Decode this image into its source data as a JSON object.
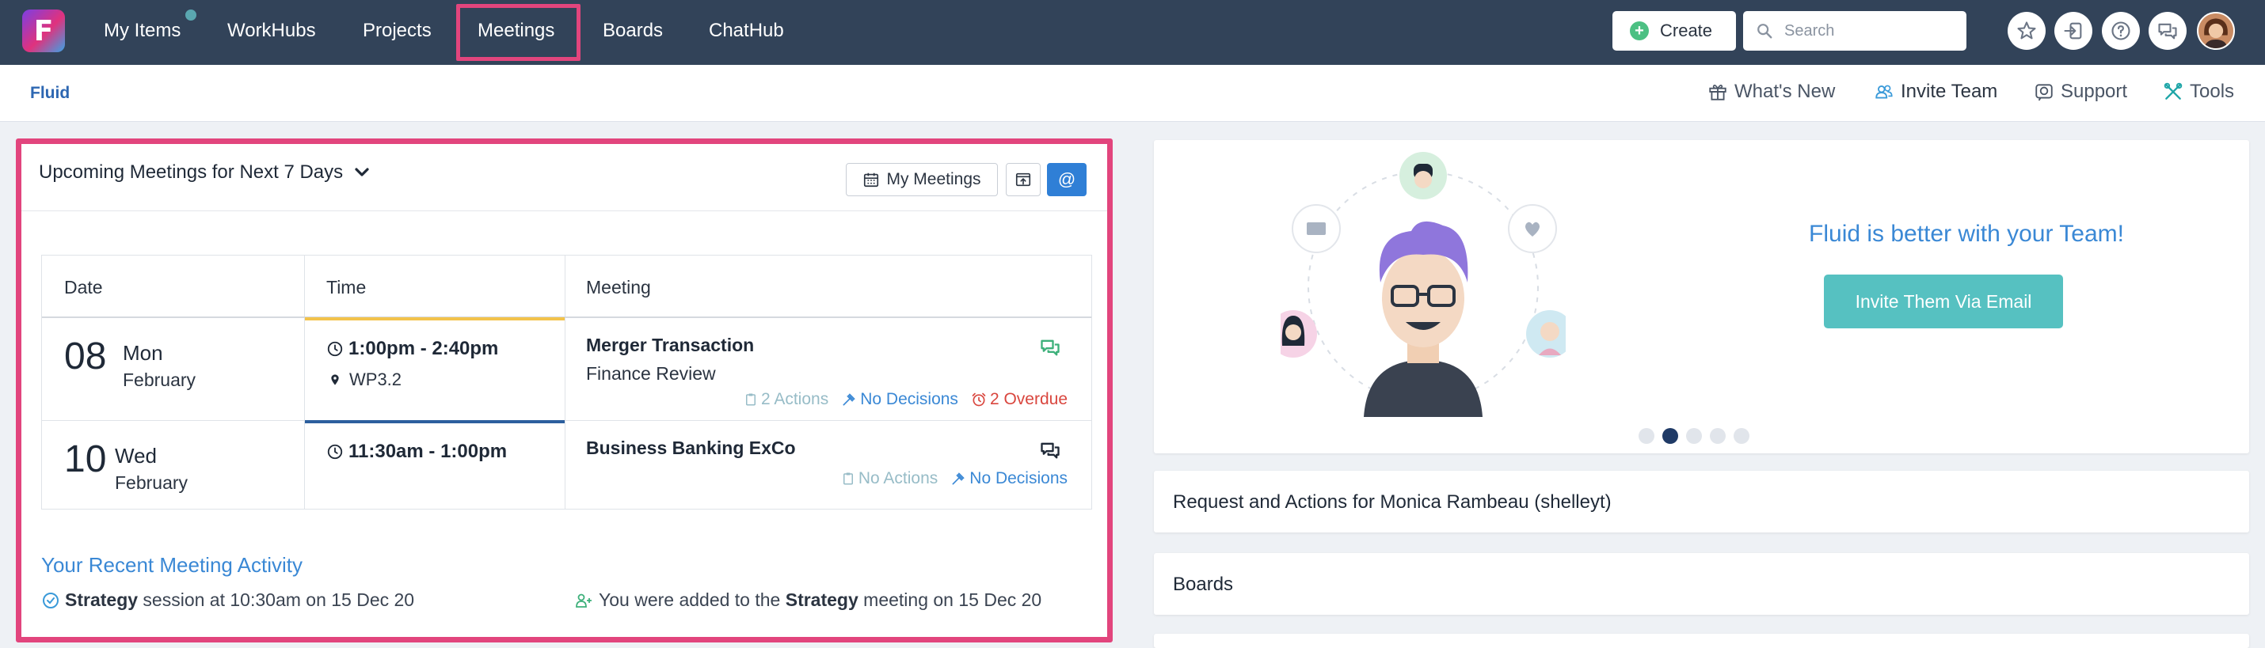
{
  "nav": {
    "logo_letter": "F",
    "items": [
      {
        "label": "My Items"
      },
      {
        "label": "WorkHubs"
      },
      {
        "label": "Projects"
      },
      {
        "label": "Meetings"
      },
      {
        "label": "Boards"
      },
      {
        "label": "ChatHub"
      }
    ],
    "create_label": "Create",
    "search_placeholder": "Search"
  },
  "subbar": {
    "breadcrumb": "Fluid",
    "links": [
      {
        "label": "What's New",
        "icon": "gift-icon"
      },
      {
        "label": "Invite Team",
        "icon": "users-icon"
      },
      {
        "label": "Support",
        "icon": "support-icon"
      },
      {
        "label": "Tools",
        "icon": "tools-icon"
      }
    ]
  },
  "meetings": {
    "title": "Upcoming Meetings for Next 7 Days",
    "my_meetings_label": "My Meetings",
    "at_label": "@",
    "columns": [
      "Date",
      "Time",
      "Meeting"
    ],
    "rows": [
      {
        "day": "08",
        "weekday": "Mon",
        "month": "February",
        "time": "1:00pm - 2:40pm",
        "location": "WP3.2",
        "title": "Merger Transaction",
        "subtitle": "Finance Review",
        "actions": "2 Actions",
        "decisions": "No Decisions",
        "overdue": "2 Overdue"
      },
      {
        "day": "10",
        "weekday": "Wed",
        "month": "February",
        "time": "11:30am - 1:00pm",
        "location": "",
        "title": "Business Banking ExCo",
        "subtitle": "",
        "actions": "No Actions",
        "decisions": "No Decisions",
        "overdue": ""
      }
    ],
    "recent_title": "Your Recent Meeting Activity",
    "activity": [
      {
        "bold": "Strategy",
        "text": " session at 10:30am on 15 Dec 20"
      },
      {
        "pre": "You were added to the ",
        "bold": "Strategy",
        "text": " meeting on 15 Dec 20"
      }
    ]
  },
  "hero": {
    "title": "Fluid is better with your Team!",
    "button": "Invite Them Via Email",
    "slides": 5,
    "active_slide": 2
  },
  "cards": [
    {
      "title": "Request and Actions for Monica Rambeau (shelleyt)"
    },
    {
      "title": "Boards"
    }
  ],
  "colors": {
    "nav_bg": "#324359",
    "highlight": "#e2457d",
    "accent_blue": "#3a88d5",
    "teal_button": "#56c1c1",
    "overdue_red": "#d9463e"
  }
}
